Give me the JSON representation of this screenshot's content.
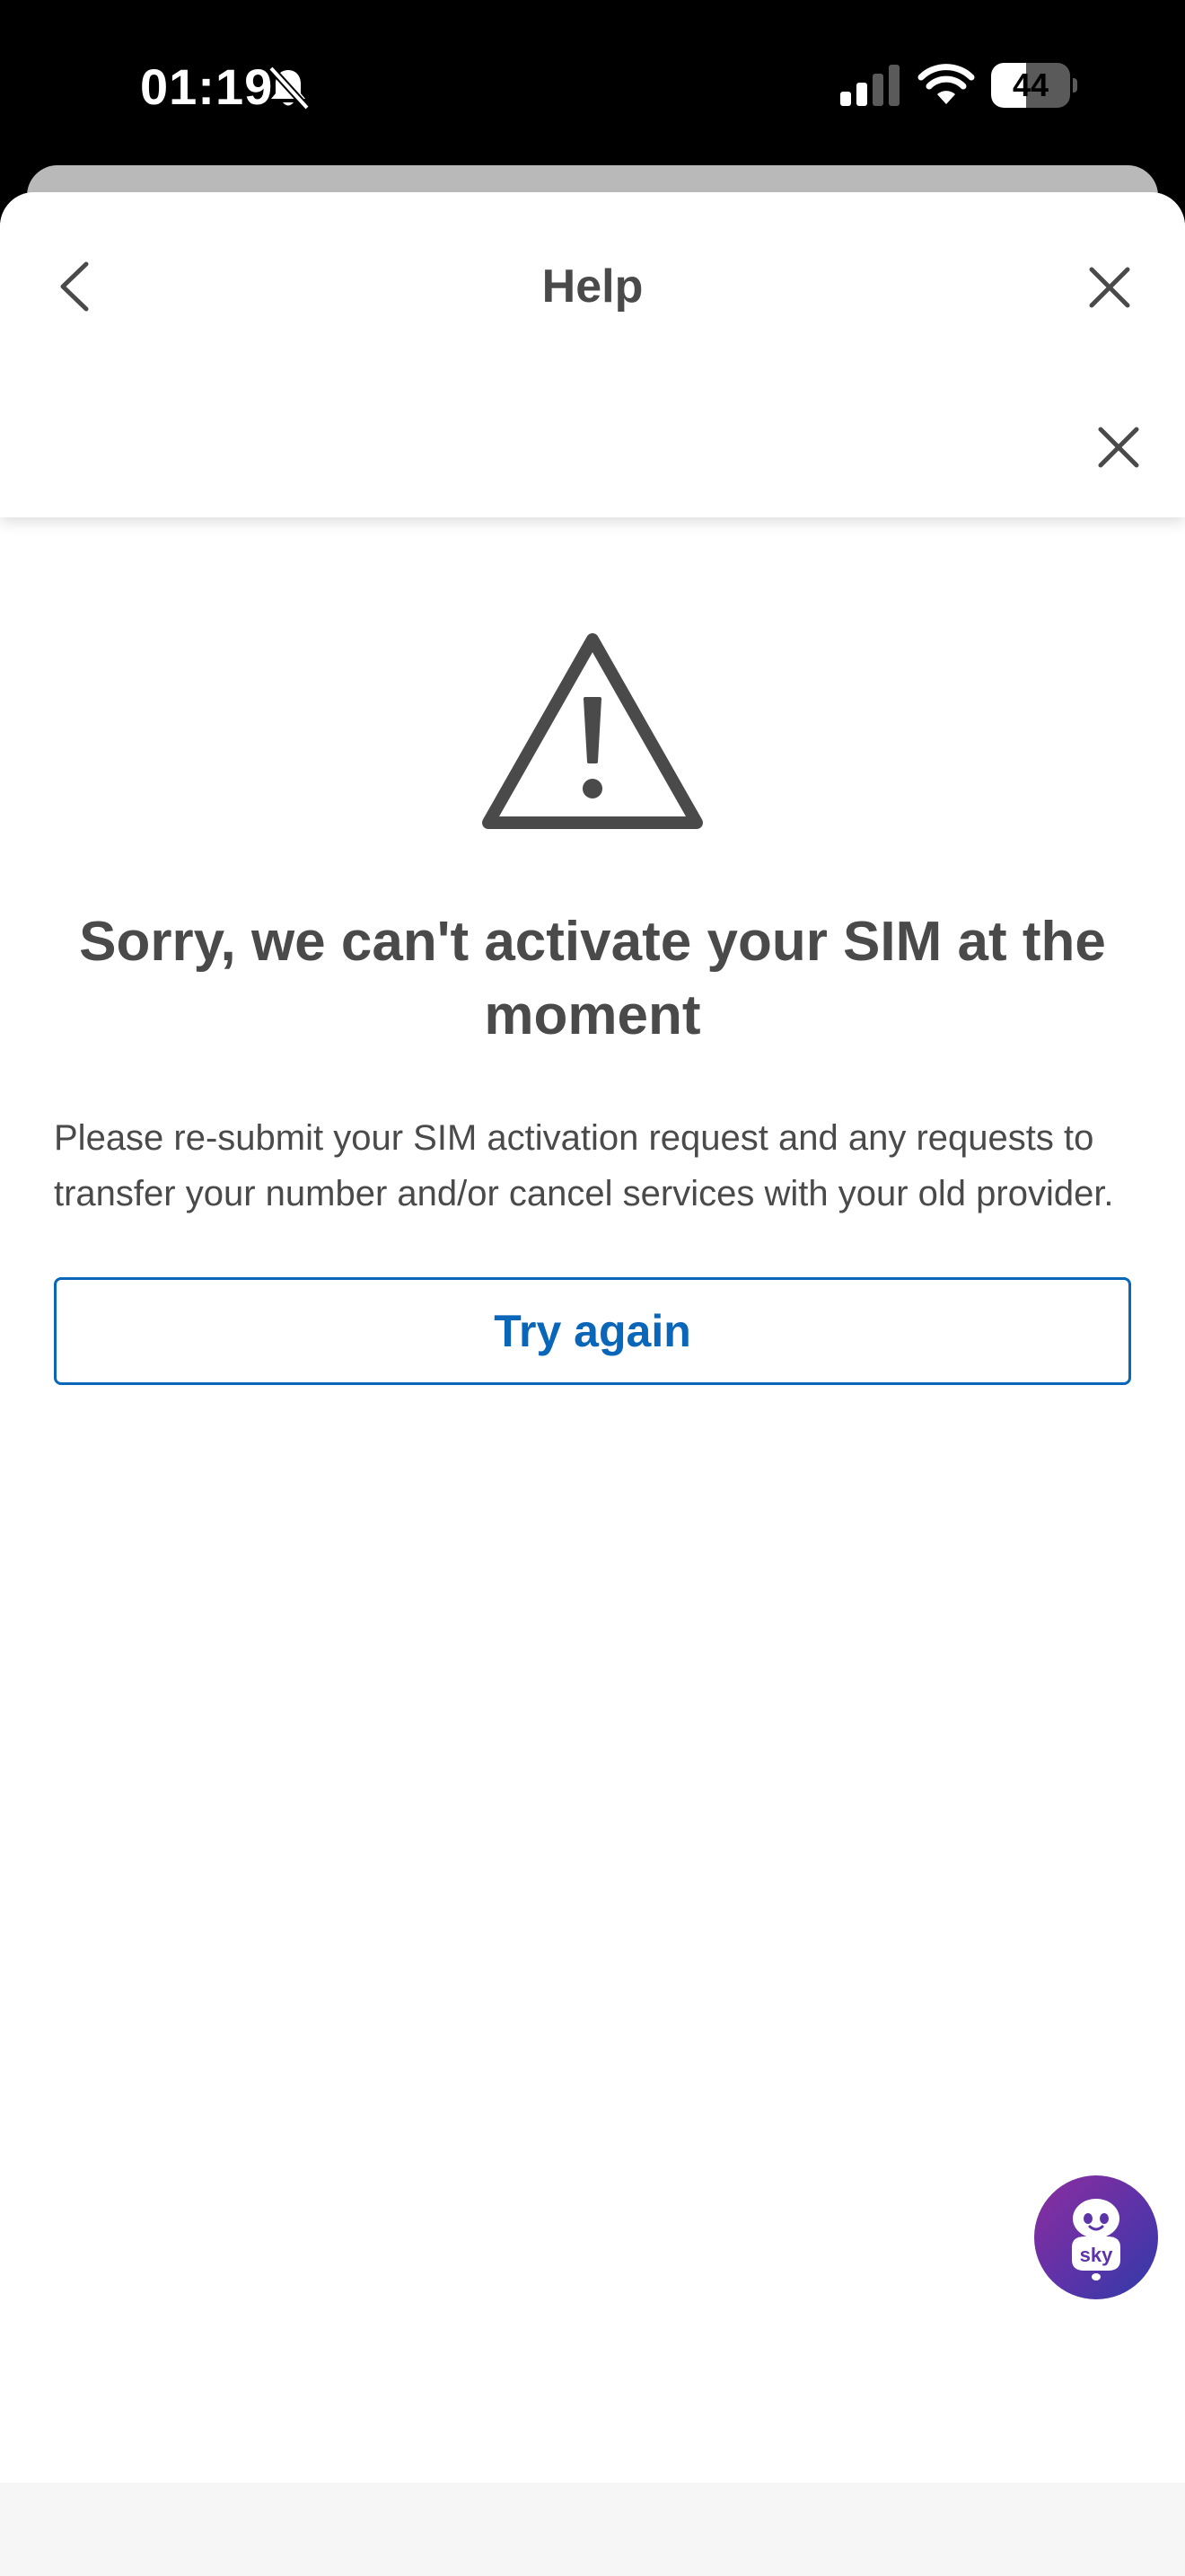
{
  "status_bar": {
    "time": "01:19",
    "battery_level": 44,
    "battery_label": "44",
    "icons": [
      "bell-slash-icon",
      "cellular-signal-icon",
      "wifi-icon",
      "battery-icon"
    ]
  },
  "header": {
    "title": "Help",
    "back_icon": "chevron-left-icon",
    "close_icon": "close-icon",
    "banner_close_icon": "close-icon"
  },
  "error": {
    "icon": "warning-triangle-icon",
    "title": "Sorry, we can't activate your SIM at the moment",
    "body": "Please re-submit your SIM activation request and any requests to transfer your number and/or cancel services with your old provider."
  },
  "actions": {
    "try_again_label": "Try again"
  },
  "chat_bot": {
    "icon": "robot-icon",
    "label": "sky"
  },
  "colors": {
    "accent_blue": "#0a66b8",
    "text_primary": "#4a4a4a",
    "chat_gradient_start": "#8c2d9e",
    "chat_gradient_end": "#2f3aa8"
  }
}
